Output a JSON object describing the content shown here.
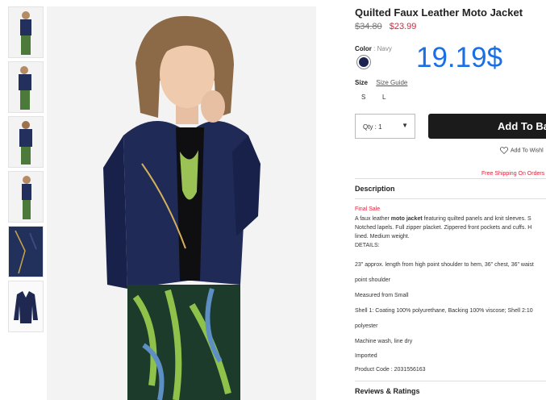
{
  "product": {
    "title": "Quilted Faux Leather Moto Jacket",
    "old_price": "$34.80",
    "sale_price": "$23.99",
    "overlay_price": "19.19$"
  },
  "color": {
    "label": "Color",
    "sep": ":",
    "value": "Navy",
    "swatch_hex": "#1c2350"
  },
  "size": {
    "label": "Size",
    "guide": "Size Guide",
    "options": [
      "S",
      "L"
    ]
  },
  "purchase": {
    "qty_label": "Qty : 1",
    "add_label": "Add To Ba",
    "wishlist": "Add To Wishl",
    "shipping": "Free Shipping On Orders"
  },
  "description": {
    "heading": "Description",
    "final_sale": "Final Sale",
    "line1_pre": "A faux leather ",
    "line1_bold": "moto jacket",
    "line1_post": " featuring quilted panels and knit sleeves. S",
    "line2": "Notched lapels. Full zipper placket. Zippered front pockets and cuffs. H",
    "line3": "lined. Medium weight.",
    "details_label": "DETAILS:",
    "details": [
      "23\" approx. length from high point shoulder to hem, 36\" chest, 36\" waist",
      "point shoulder",
      "Measured from Small",
      "Shell 1: Coating 100% polyurethane, Backing 100% viscose; Shell 2:10",
      "polyester",
      "Machine wash, line dry",
      "Imported"
    ],
    "product_code": "Product Code : 2031556163"
  },
  "reviews": {
    "heading": "Reviews & Ratings"
  },
  "colors": {
    "accent_price": "#d9263d",
    "overlay_blue": "#1a6fe6",
    "button": "#1b1b1b"
  }
}
